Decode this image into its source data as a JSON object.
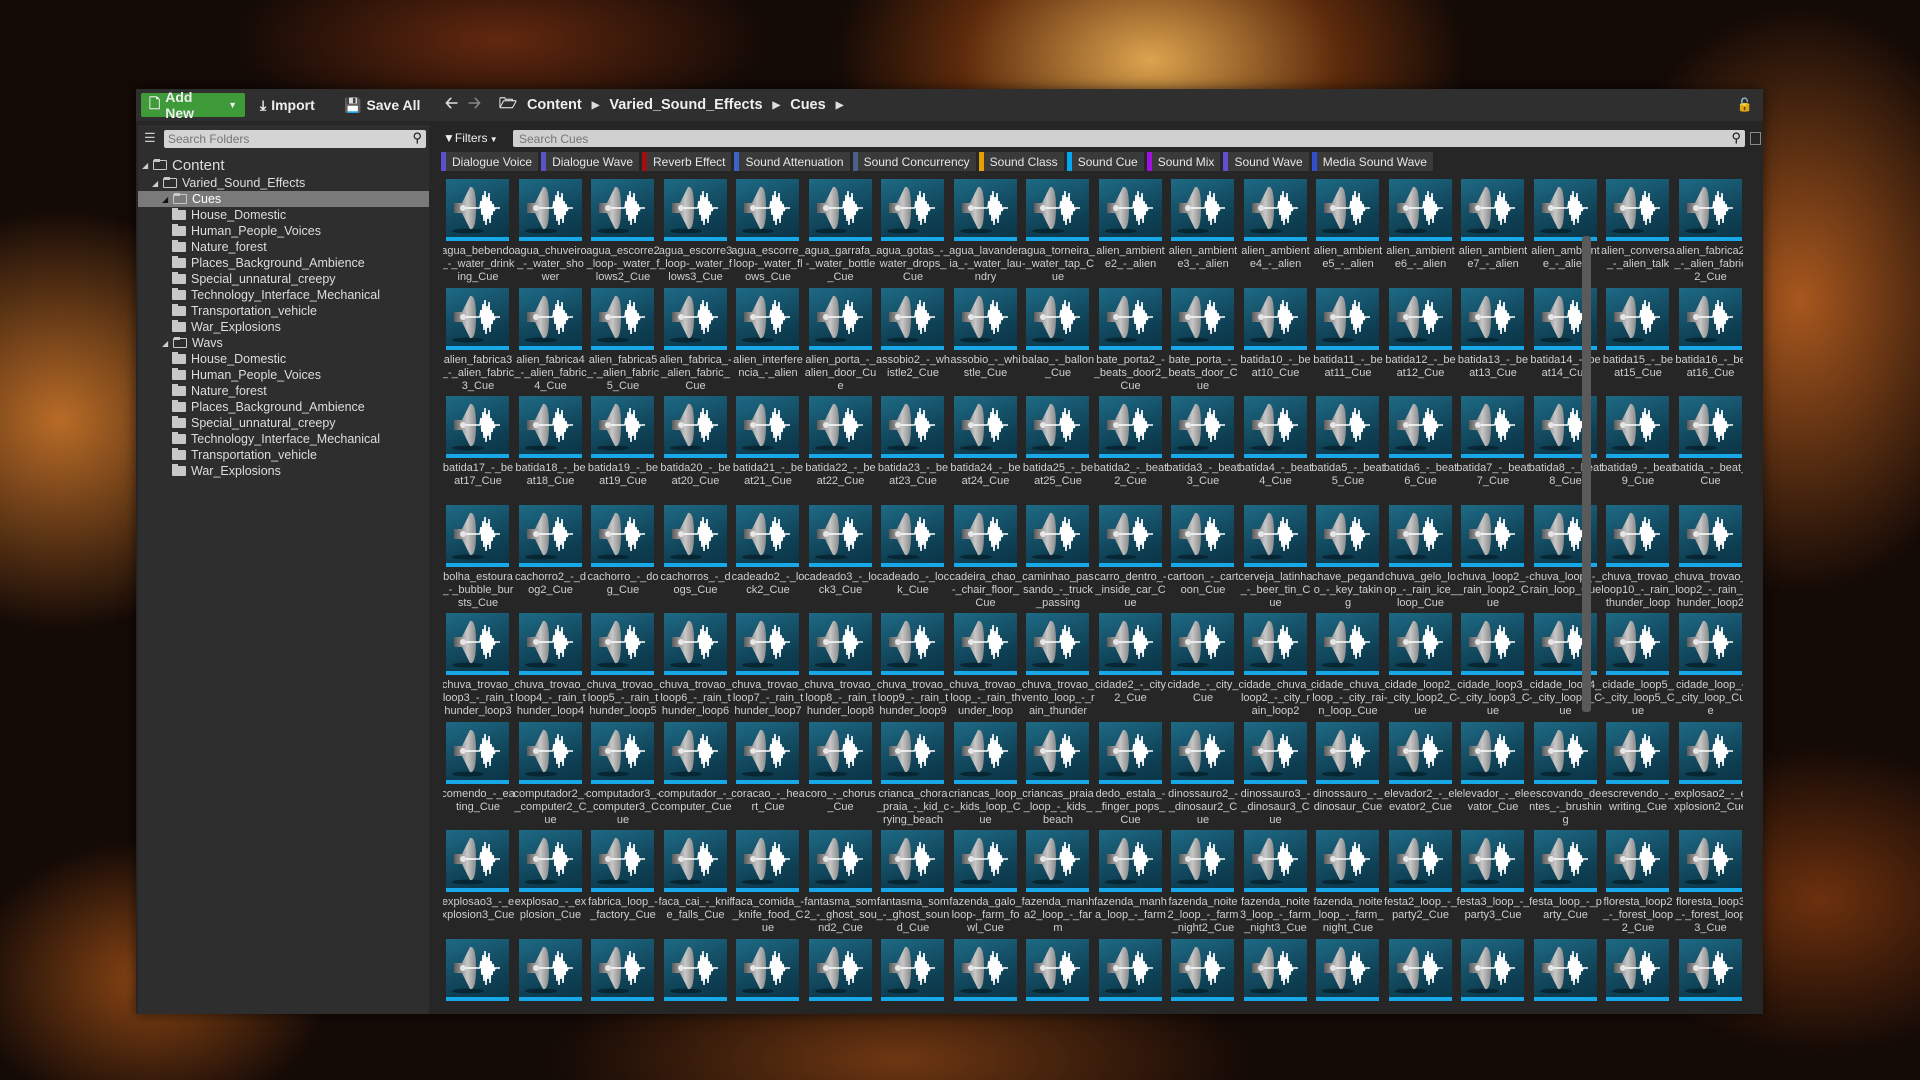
{
  "toolbar": {
    "add_new": "Add New",
    "import": "Import",
    "save_all": "Save All"
  },
  "folders": {
    "search_placeholder": "Search Folders",
    "root": "Content",
    "project": "Varied_Sound_Effects",
    "cues": {
      "label": "Cues",
      "children": [
        "House_Domestic",
        "Human_People_Voices",
        "Nature_forest",
        "Places_Background_Ambience",
        "Special_unnatural_creepy",
        "Technology_Interface_Mechanical",
        "Transportation_vehicle",
        "War_Explosions"
      ]
    },
    "wavs": {
      "label": "Wavs",
      "children": [
        "House_Domestic",
        "Human_People_Voices",
        "Nature_forest",
        "Places_Background_Ambience",
        "Special_unnatural_creepy",
        "Technology_Interface_Mechanical",
        "Transportation_vehicle",
        "War_Explosions"
      ]
    }
  },
  "breadcrumb": [
    "Content",
    "Varied_Sound_Effects",
    "Cues"
  ],
  "search": {
    "filters_label": "Filters",
    "placeholder": "Search Cues"
  },
  "filter_chips": [
    {
      "label": "Dialogue Voice",
      "color": "#5b4fd6"
    },
    {
      "label": "Dialogue Wave",
      "color": "#5a52c8"
    },
    {
      "label": "Reverb Effect",
      "color": "#a01010"
    },
    {
      "label": "Sound Attenuation",
      "color": "#3b63c9"
    },
    {
      "label": "Sound Concurrency",
      "color": "#4a5f8a"
    },
    {
      "label": "Sound Class",
      "color": "#e8a000"
    },
    {
      "label": "Sound Cue",
      "color": "#00a8f0"
    },
    {
      "label": "Sound Mix",
      "color": "#a010e0"
    },
    {
      "label": "Sound Wave",
      "color": "#6050d0"
    },
    {
      "label": "Media Sound Wave",
      "color": "#3050d0"
    }
  ],
  "assets": [
    [
      "agua_bebendo_-_water_drinking_Cue",
      "agua_chuveiro_-_water_shower",
      "agua_escorre2_loop-_water_flows2_Cue",
      "agua_escorre3_loop-_water_flows3_Cue",
      "agua_escorre_loop-_water_flows_Cue",
      "agua_garrafa_-_water_bottle_Cue",
      "agua_gotas_-_water_drops_Cue",
      "agua_lavanderia_-_water_laundry",
      "agua_torneira_-_water_tap_Cue",
      "alien_ambiente2_-_alien",
      "alien_ambiente3_-_alien",
      "alien_ambiente4_-_alien",
      "alien_ambiente5_-_alien",
      "alien_ambiente6_-_alien",
      "alien_ambiente7_-_alien",
      "alien_ambiente_-_alien",
      "alien_conversa_-_alien_talk",
      "alien_fabrica2_-_alien_fabric2_Cue"
    ],
    [
      "alien_fabrica3_-_alien_fabric3_Cue",
      "alien_fabrica4_-_alien_fabric4_Cue",
      "alien_fabrica5_-_alien_fabric5_Cue",
      "alien_fabrica_-_alien_fabric_Cue",
      "alien_interferencia_-_alien",
      "alien_porta_-_alien_door_Cue",
      "assobio2_-_whistle2_Cue",
      "assobio_-_whistle_Cue",
      "balao_-_ballon_Cue",
      "bate_porta2_-_beats_door2_Cue",
      "bate_porta_-_beats_door_Cue",
      "batida10_-_beat10_Cue",
      "batida11_-_beat11_Cue",
      "batida12_-_beat12_Cue",
      "batida13_-_beat13_Cue",
      "batida14_-_beat14_Cue",
      "batida15_-_beat15_Cue",
      "batida16_-_beat16_Cue"
    ],
    [
      "batida17_-_beat17_Cue",
      "batida18_-_beat18_Cue",
      "batida19_-_beat19_Cue",
      "batida20_-_beat20_Cue",
      "batida21_-_beat21_Cue",
      "batida22_-_beat22_Cue",
      "batida23_-_beat23_Cue",
      "batida24_-_beat24_Cue",
      "batida25_-_beat25_Cue",
      "batida2_-_beat2_Cue",
      "batida3_-_beat3_Cue",
      "batida4_-_beat4_Cue",
      "batida5_-_beat5_Cue",
      "batida6_-_beat6_Cue",
      "batida7_-_beat7_Cue",
      "batida8_-_beat8_Cue",
      "batida9_-_beat9_Cue",
      "batida_-_beat_Cue"
    ],
    [
      "bolha_estoura_-_bubble_bursts_Cue",
      "cachorro2_-_dog2_Cue",
      "cachorro_-_dog_Cue",
      "cachorros_-_dogs_Cue",
      "cadeado2_-_lock2_Cue",
      "cadeado3_-_lock3_Cue",
      "cadeado_-_lock_Cue",
      "cadeira_chao_-_chair_floor_Cue",
      "caminhao_passando_-_truck_passing",
      "carro_dentro_-_inside_car_Cue",
      "cartoon_-_cartoon_Cue",
      "cerveja_latinha_-_beer_tin_Cue",
      "chave_pegando_-_key_taking",
      "chuva_gelo_loop_-_rain_ice_loop_Cue",
      "chuva_loop2_-_rain_loop2_Cue",
      "chuva_loop_-_rain_loop_Cue",
      "chuva_trovao_loop10_-_rain_thunder_loop",
      "chuva_trovao_loop2_-_rain_thunder_loop2"
    ],
    [
      "chuva_trovao_loop3_-_rain_thunder_loop3",
      "chuva_trovao_loop4_-_rain_thunder_loop4",
      "chuva_trovao_loop5_-_rain_thunder_loop5",
      "chuva_trovao_loop6_-_rain_thunder_loop6",
      "chuva_trovao_loop7_-_rain_thunder_loop7",
      "chuva_trovao_loop8_-_rain_thunder_loop8",
      "chuva_trovao_loop9_-_rain_thunder_loop9",
      "chuva_trovao_loop_-_rain_thunder_loop",
      "chuva_trovao_vento_loop_-_rain_thunder",
      "cidade2_-_city2_Cue",
      "cidade_-_city_Cue",
      "cidade_chuva_loop2_-_city_rain_loop2",
      "cidade_chuva_loop_-_city_rain_loop_Cue",
      "cidade_loop2_-_city_loop2_Cue",
      "cidade_loop3_-_city_loop3_Cue",
      "cidade_loop4_-_city_loop4_Cue",
      "cidade_loop5_-_city_loop5_Cue",
      "cidade_loop_-_city_loop_Cue"
    ],
    [
      "comendo_-_eating_Cue",
      "computador2_-_computer2_Cue",
      "computador3_-_computer3_Cue",
      "computador_-_computer_Cue",
      "coracao_-_heart_Cue",
      "coro_-_chorus_Cue",
      "crianca_chora_praia_-_kid_crying_beach",
      "criancas_loop_-_kids_loop_Cue",
      "criancas_praia_loop_-_kids_beach",
      "dedo_estala_-_finger_pops_Cue",
      "dinossauro2_-_dinosaur2_Cue",
      "dinossauro3_-_dinosaur3_Cue",
      "dinossauro_-_dinosaur_Cue",
      "elevador2_-_elevator2_Cue",
      "elevador_-_elevator_Cue",
      "escovando_dentes_-_brushing",
      "escrevendo_-_writing_Cue",
      "explosao2_-_explosion2_Cue"
    ],
    [
      "explosao3_-_explosion3_Cue",
      "explosao_-_explosion_Cue",
      "fabrica_loop_-_factory_Cue",
      "faca_cai_-_knife_falls_Cue",
      "faca_comida_-_knife_food_Cue",
      "fantasma_som2_-_ghost_sound2_Cue",
      "fantasma_som_-_ghost_sound_Cue",
      "fazenda_galo_loop-_farm_fowl_Cue",
      "fazenda_manha2_loop_-_farm",
      "fazenda_manha_loop_-_farm",
      "fazenda_noite2_loop_-_farm_night2_Cue",
      "fazenda_noite3_loop_-_farm_night3_Cue",
      "fazenda_noite_loop_-_farm_night_Cue",
      "festa2_loop_-_party2_Cue",
      "festa3_loop_-_party3_Cue",
      "festa_loop_-_party_Cue",
      "floresta_loop2_-_forest_loop2_Cue",
      "floresta_loop3_-_forest_loop3_Cue"
    ],
    [
      "",
      "",
      "",
      "",
      "",
      "",
      "",
      "",
      "",
      "",
      "",
      "",
      "",
      "",
      "",
      "",
      "",
      ""
    ]
  ]
}
